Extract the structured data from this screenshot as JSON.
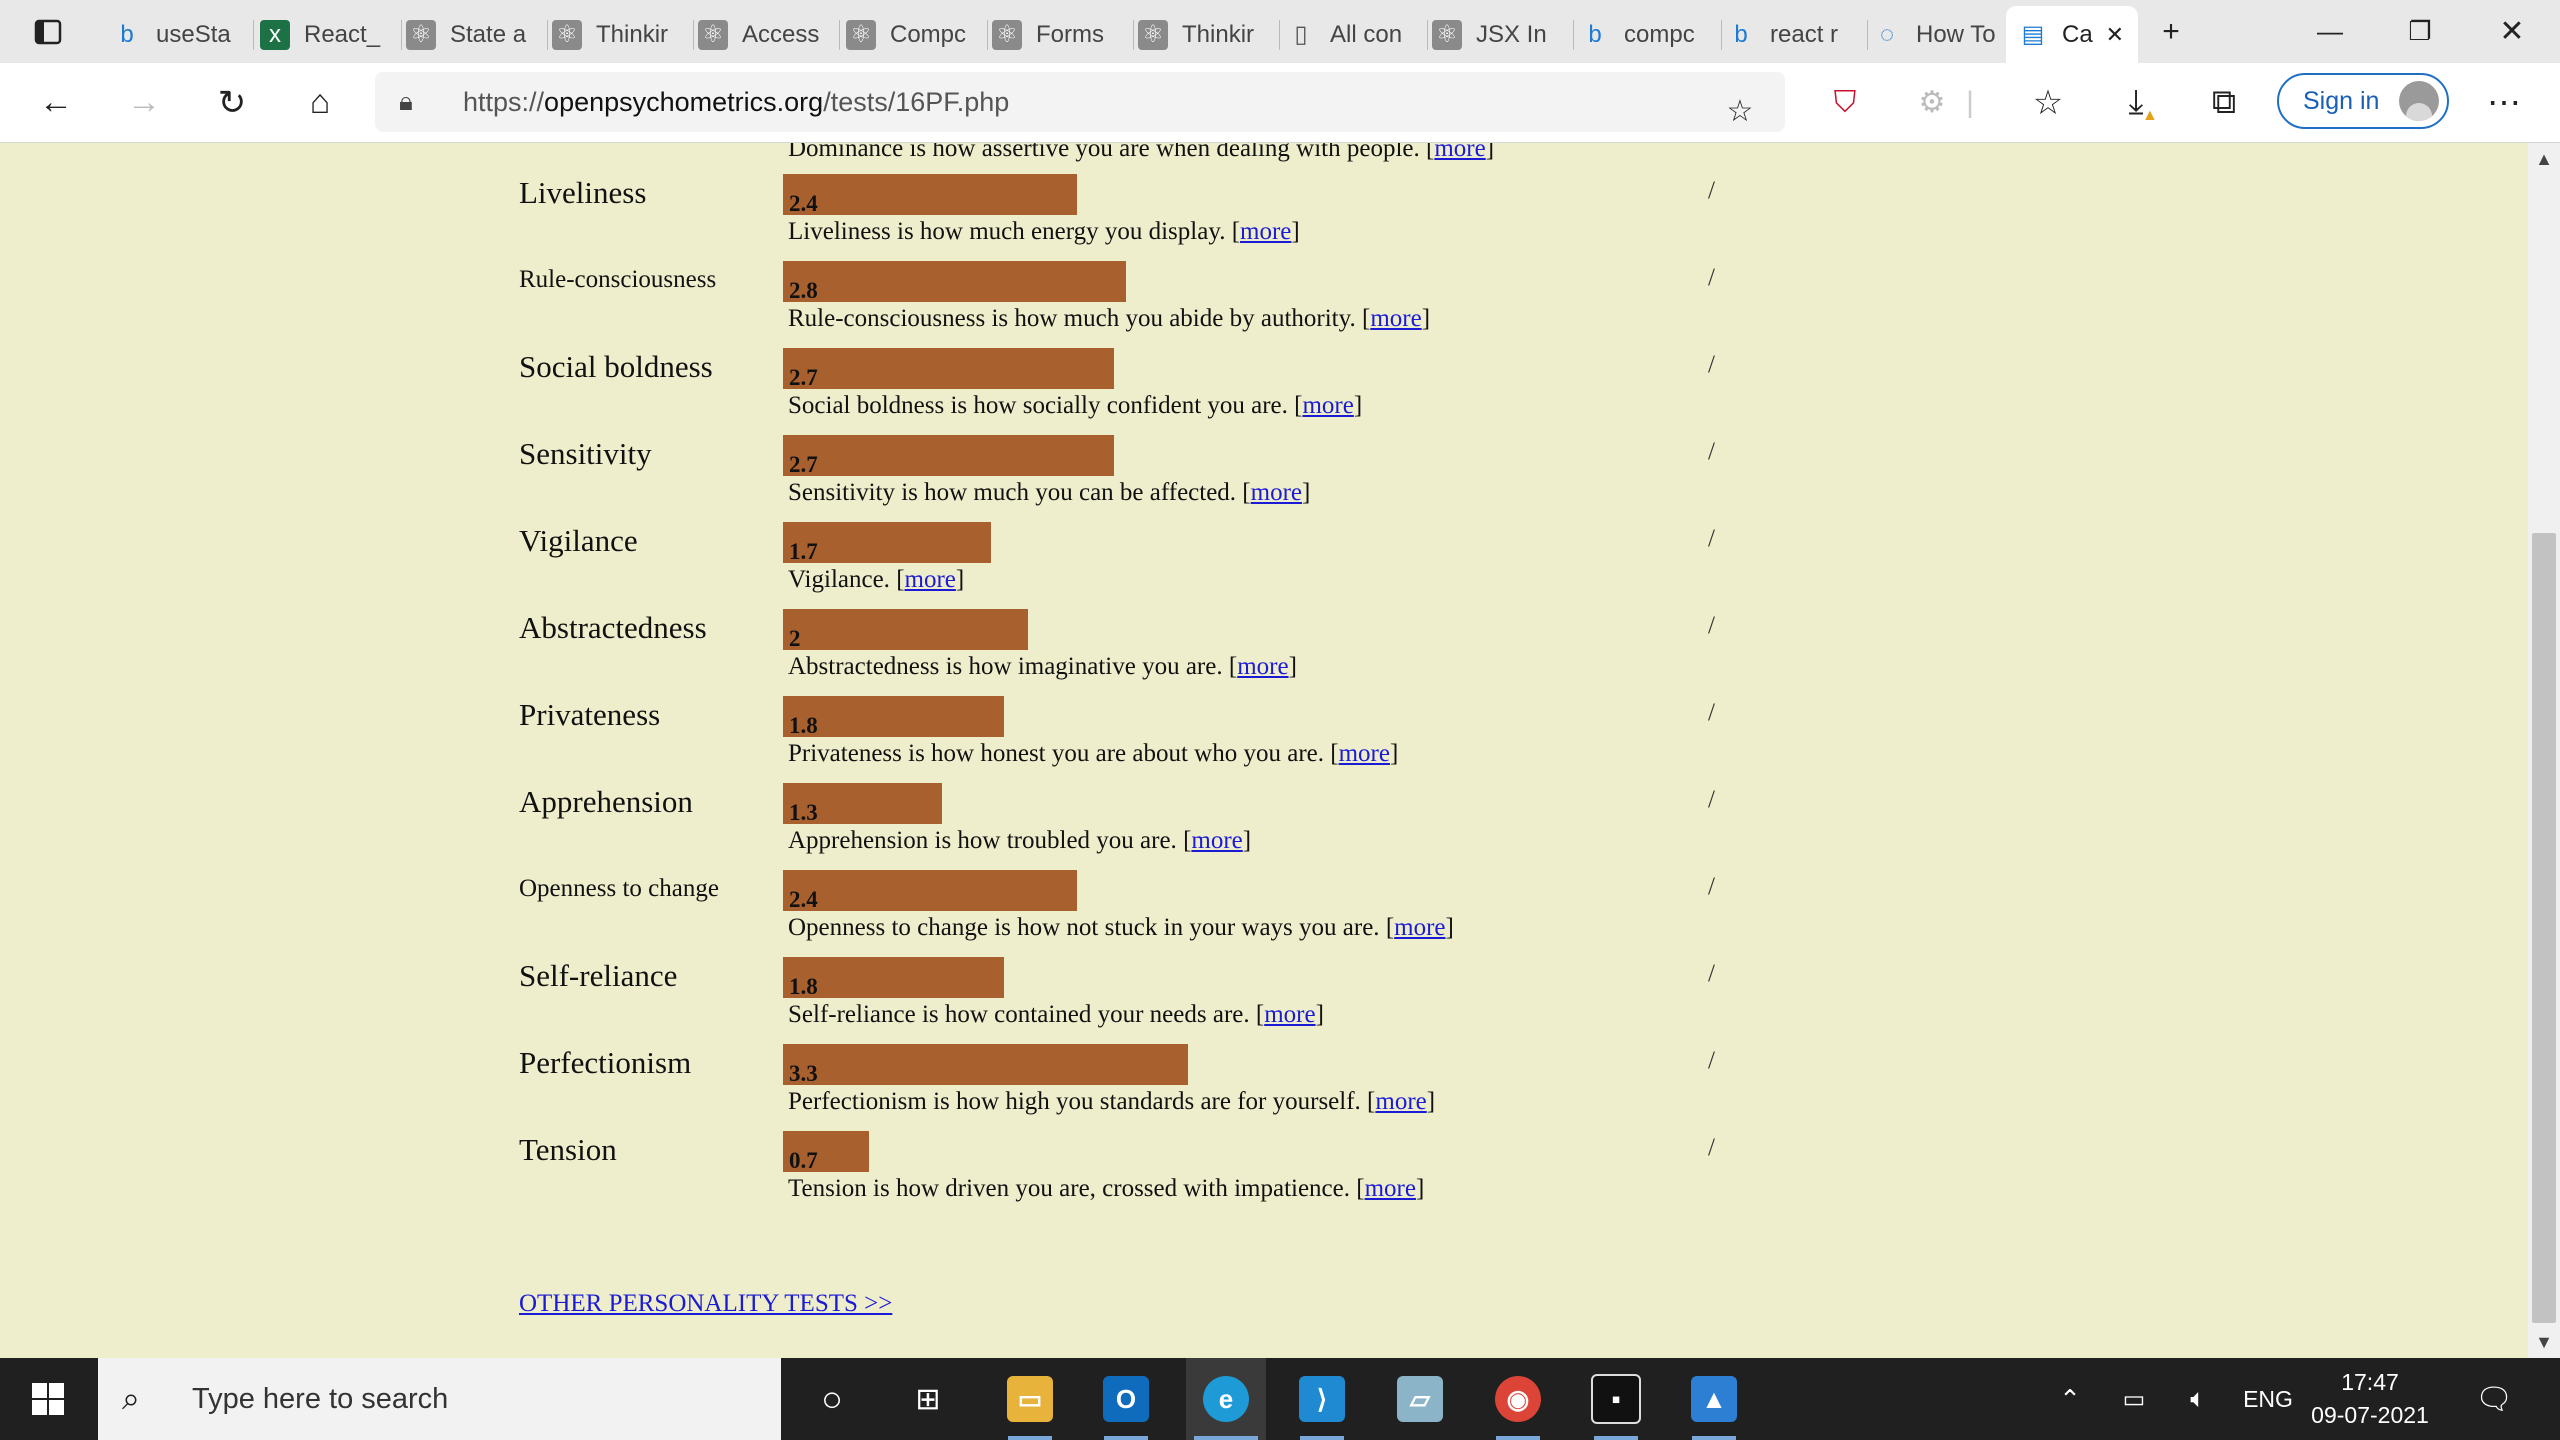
{
  "browser": {
    "tabs": [
      {
        "title": "useSta",
        "icon": "bing-icon"
      },
      {
        "title": "React_",
        "icon": "excel-icon"
      },
      {
        "title": "State a",
        "icon": "react-icon"
      },
      {
        "title": "Thinkir",
        "icon": "react-icon"
      },
      {
        "title": "Access",
        "icon": "react-icon"
      },
      {
        "title": "Compc",
        "icon": "react-icon"
      },
      {
        "title": "Forms",
        "icon": "react-icon"
      },
      {
        "title": "Thinkir",
        "icon": "react-icon"
      },
      {
        "title": "All con",
        "icon": "page-icon"
      },
      {
        "title": "JSX In",
        "icon": "react-icon"
      },
      {
        "title": "compc",
        "icon": "bing-icon"
      },
      {
        "title": "react r",
        "icon": "bing-icon"
      },
      {
        "title": "How To",
        "icon": "loading-icon"
      },
      {
        "title": "Ca",
        "icon": "reader-icon"
      }
    ],
    "url_prefix": "https://",
    "url_domain": "openpsychometrics.org",
    "url_path": "/tests/16PF.php",
    "sign_in_label": "Sign in"
  },
  "page": {
    "top_partial_desc": "Dominance is how assertive you are when dealing with people.",
    "more_label": "more",
    "slash": "/",
    "scale_max": 5,
    "traits": [
      {
        "name": "Liveliness",
        "score": "2.4",
        "value": 2.4,
        "desc": "Liveliness is how much energy you display.",
        "small": false
      },
      {
        "name": "Rule-consciousness",
        "score": "2.8",
        "value": 2.8,
        "desc": "Rule-consciousness is how much you abide by authority.",
        "small": true
      },
      {
        "name": "Social boldness",
        "score": "2.7",
        "value": 2.7,
        "desc": "Social boldness is how socially confident you are.",
        "small": false
      },
      {
        "name": "Sensitivity",
        "score": "2.7",
        "value": 2.7,
        "desc": "Sensitivity is how much you can be affected.",
        "small": false
      },
      {
        "name": "Vigilance",
        "score": "1.7",
        "value": 1.7,
        "desc": "Vigilance.",
        "small": false
      },
      {
        "name": "Abstractedness",
        "score": "2",
        "value": 2.0,
        "desc": "Abstractedness is how imaginative you are.",
        "small": false
      },
      {
        "name": "Privateness",
        "score": "1.8",
        "value": 1.8,
        "desc": "Privateness is how honest you are about who you are.",
        "small": false
      },
      {
        "name": "Apprehension",
        "score": "1.3",
        "value": 1.3,
        "desc": "Apprehension is how troubled you are.",
        "small": false
      },
      {
        "name": "Openness to change",
        "score": "2.4",
        "value": 2.4,
        "desc": "Openness to change is how not stuck in your ways you are.",
        "small": true
      },
      {
        "name": "Self-reliance",
        "score": "1.8",
        "value": 1.8,
        "desc": "Self-reliance is how contained your needs are.",
        "small": false
      },
      {
        "name": "Perfectionism",
        "score": "3.3",
        "value": 3.3,
        "desc": "Perfectionism is how high you standards are for yourself.",
        "small": false
      },
      {
        "name": "Tension",
        "score": "0.7",
        "value": 0.7,
        "desc": "Tension is how driven you are, crossed with impatience.",
        "small": false
      }
    ],
    "other_tests_link": "OTHER PERSONALITY TESTS >>",
    "bar_color": "#a8612e"
  },
  "taskbar": {
    "search_placeholder": "Type here to search",
    "language": "ENG",
    "time": "17:47",
    "date": "09-07-2021"
  }
}
